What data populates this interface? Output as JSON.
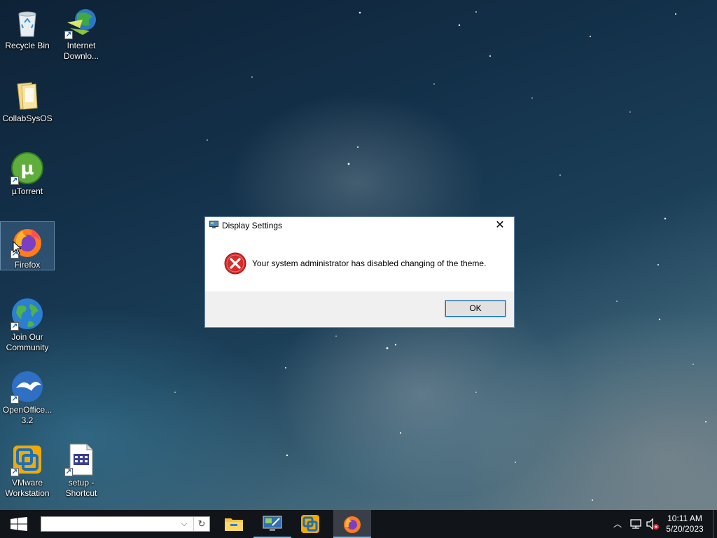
{
  "desktop": {
    "icons": [
      {
        "label": "Recycle Bin",
        "icon": "recycle-bin-icon"
      },
      {
        "label": "Internet Downlo...",
        "icon": "internet-download-manager-icon"
      },
      {
        "label": "CollabSysOS",
        "icon": "folder-icon"
      },
      {
        "label": "µTorrent",
        "icon": "utorrent-icon"
      },
      {
        "label": "Firefox",
        "icon": "firefox-icon"
      },
      {
        "label": "Join Our Community",
        "icon": "globe-icon"
      },
      {
        "label": "OpenOffice... 3.2",
        "icon": "openoffice-icon"
      },
      {
        "label": "VMware Workstation",
        "icon": "vmware-icon"
      },
      {
        "label": "setup - Shortcut",
        "icon": "setup-file-icon"
      }
    ]
  },
  "dialog": {
    "title": "Display Settings",
    "message": "Your system administrator has disabled changing of the theme.",
    "ok_label": "OK",
    "close_glyph": "✕"
  },
  "taskbar": {
    "search_value": "",
    "apps": [
      {
        "name": "File Explorer",
        "icon": "file-explorer-icon",
        "running": false
      },
      {
        "name": "Display",
        "icon": "monitor-icon",
        "running": true
      },
      {
        "name": "VMware Workstation",
        "icon": "vmware-icon",
        "running": false
      },
      {
        "name": "Firefox",
        "icon": "firefox-icon",
        "running": true,
        "active": true
      }
    ],
    "time": "10:11 AM",
    "date": "5/20/2023"
  },
  "colors": {
    "accent": "#0078d7",
    "taskbar": "#111418",
    "error_red": "#d52b2b"
  }
}
